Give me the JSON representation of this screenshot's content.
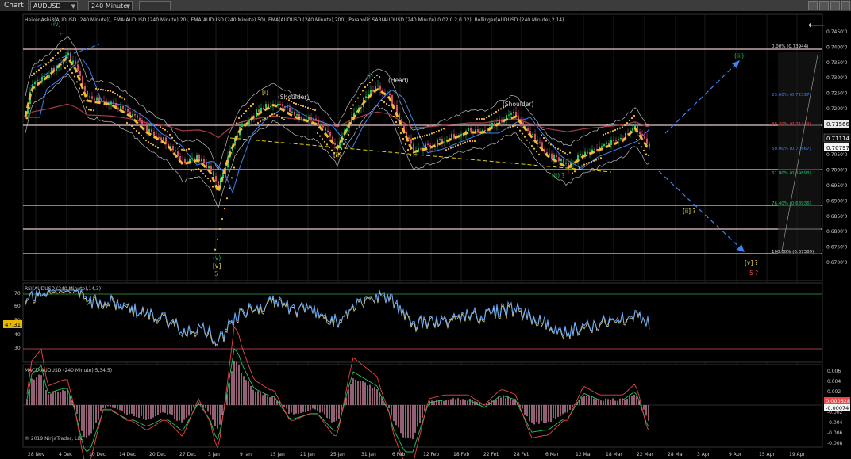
{
  "toolbar": {
    "tab": "Chart",
    "instrument": "AUDUSD",
    "interval": "240 Minute"
  },
  "price_panel": {
    "indicators_label": "HeikenAshi8(AUDUSD (240 Minute)), EMA(AUDUSD (240 Minute),20), EMA(AUDUSD (240 Minute),50), EMA(AUDUSD (240 Minute),200), Parabolic SAR(AUDUSD (240 Minute),0.02,0.2,0.02), Bollinger(AUDUSD (240 Minute),2,14)",
    "y_ticks": [
      "0.7450'0",
      "0.7400'0",
      "0.7350'0",
      "0.7300'0",
      "0.7250'0",
      "0.7200'0",
      "0.7150'0",
      "0.7100'0",
      "0.7050'0",
      "0.7000'0",
      "0.6950'0",
      "0.6900'0",
      "0.6850'0",
      "0.6800'0",
      "0.6750'0",
      "0.6700'0"
    ],
    "price_badges": {
      "upper": "0.71566",
      "current": "0.71114",
      "lower": "0.70797"
    },
    "fib_levels": [
      {
        "label": "0.00% (0.73944)",
        "color": "#dddddd"
      },
      {
        "label": "23.60% (0.72397)",
        "color": "#3b82f6"
      },
      {
        "label": "38.20% (0.71440)",
        "color": "#ef4444"
      },
      {
        "label": "50.00% (0.70667)",
        "color": "#3b82f6"
      },
      {
        "label": "61.80% (0.69893)",
        "color": "#22c55e"
      },
      {
        "label": "76.40% (0.68936)",
        "color": "#22c55e"
      },
      {
        "label": "100.00% (0.67389)",
        "color": "#dddddd"
      }
    ],
    "wave_labels": {
      "iv": "(iv)",
      "c": "c",
      "i_sq": "[i]",
      "shoulder_left": "(Shoulder)",
      "i_paren": "(i)",
      "head": "(Head)",
      "shoulder_right": "(Shoulder)",
      "ii_sq": "[ii]",
      "ii_q": "(ii) ?",
      "iii": "(iii)",
      "ii_sq_q": "[ii] ?",
      "v_paren": "(v)",
      "v_sq": "[v]",
      "five": "5",
      "v_sq_q": "[v] ?",
      "five_q": "5 ?"
    }
  },
  "rsi_panel": {
    "label": "RSI(AUDUSD (240 Minute),14,3)",
    "y_ticks": [
      "70",
      "60",
      "50",
      "40",
      "30"
    ],
    "badge": "47.31"
  },
  "macd_panel": {
    "label": "MACD(AUDUSD (240 Minute),5,34,5)",
    "y_ticks": [
      "0.006",
      "0.004",
      "0.002",
      "-0.002",
      "-0.004",
      "-0.006",
      "-0.008"
    ],
    "badges": {
      "upper": "0.000628",
      "lower": "-0.00074"
    }
  },
  "copyright": "© 2019 NinjaTrader, LLC",
  "x_ticks": [
    "28 Nov",
    "4 Dec",
    "10 Dec",
    "14 Dec",
    "20 Dec",
    "27 Dec",
    "3 Jan",
    "9 Jan",
    "15 Jan",
    "21 Jan",
    "25 Jan",
    "31 Jan",
    "6 Feb",
    "12 Feb",
    "18 Feb",
    "22 Feb",
    "28 Feb",
    "6 Mar",
    "12 Mar",
    "18 Mar",
    "22 Mar",
    "28 Mar",
    "3 Apr",
    "9 Apr",
    "15 Apr",
    "19 Apr"
  ],
  "colors": {
    "ema20": "#f0b93a",
    "ema50": "#3b82f6",
    "ema200": "#a33a4a",
    "sar": "#f0b93a",
    "bull": "#22c55e",
    "bear": "#d0506a",
    "rsi": "#60a5fa",
    "rsi_signal": "#e6d27a",
    "macd": "#ef4444",
    "macd_signal": "#22c55e",
    "macd_hist": "#f4a0c0"
  }
}
